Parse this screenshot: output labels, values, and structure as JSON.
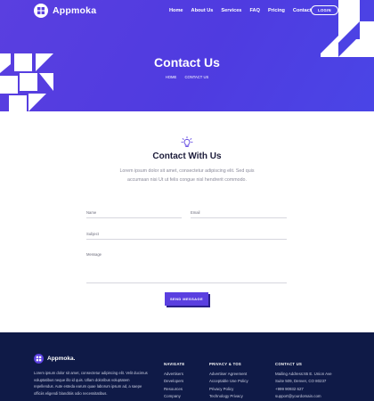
{
  "brand": {
    "name": "Appmoka"
  },
  "nav": {
    "items": [
      "Home",
      "About Us",
      "Services",
      "FAQ",
      "Pricing",
      "Contact"
    ],
    "login": "LOGIN"
  },
  "hero": {
    "title": "Contact Us",
    "crumbs": [
      "HOME",
      "CONTACT US"
    ]
  },
  "contact": {
    "title": "Contact With Us",
    "description": "Lorem ipsum dolor sit amet, consectetur adipiscing elit. Sed quis accumsan nisi Ut ut felis congue nisl hendrerit commodo.",
    "fields": {
      "name": "Name",
      "email": "Email",
      "subject": "Subject",
      "message": "Message"
    },
    "send": "SEND MESSAGE"
  },
  "footer": {
    "brand": "Appmoka.",
    "about": "Lorem ipsum dolor sit amet, consectetur adipiscing elit. Velit ducimus voluptatibus neque illo id quis. Ullam doloribus voluptatem repellendus. Aute esteda earum quae laborum ipsum ad, a saepe officiis eligendi blanditiis odio necessitatibus.",
    "columns": [
      {
        "title": "NAVIGATE",
        "items": [
          "Advertisers",
          "Developers",
          "Resources",
          "Company"
        ]
      },
      {
        "title": "PRIVACY & TOS",
        "items": [
          "Advertiser Agreement",
          "Acceptable Use Policy",
          "Privacy Policy",
          "Technology Privacy"
        ]
      },
      {
        "title": "CONTACT US",
        "items": [
          "Mailing Address:65 E. Union Ave",
          "Suite 509, Denver, CO 80237",
          "+999 90932 627",
          "support@yourdomain.com"
        ]
      }
    ]
  },
  "colors": {
    "primary": "#5a3fe0",
    "footer": "#0f1a47",
    "accent_icon": "#5a3fe0"
  }
}
